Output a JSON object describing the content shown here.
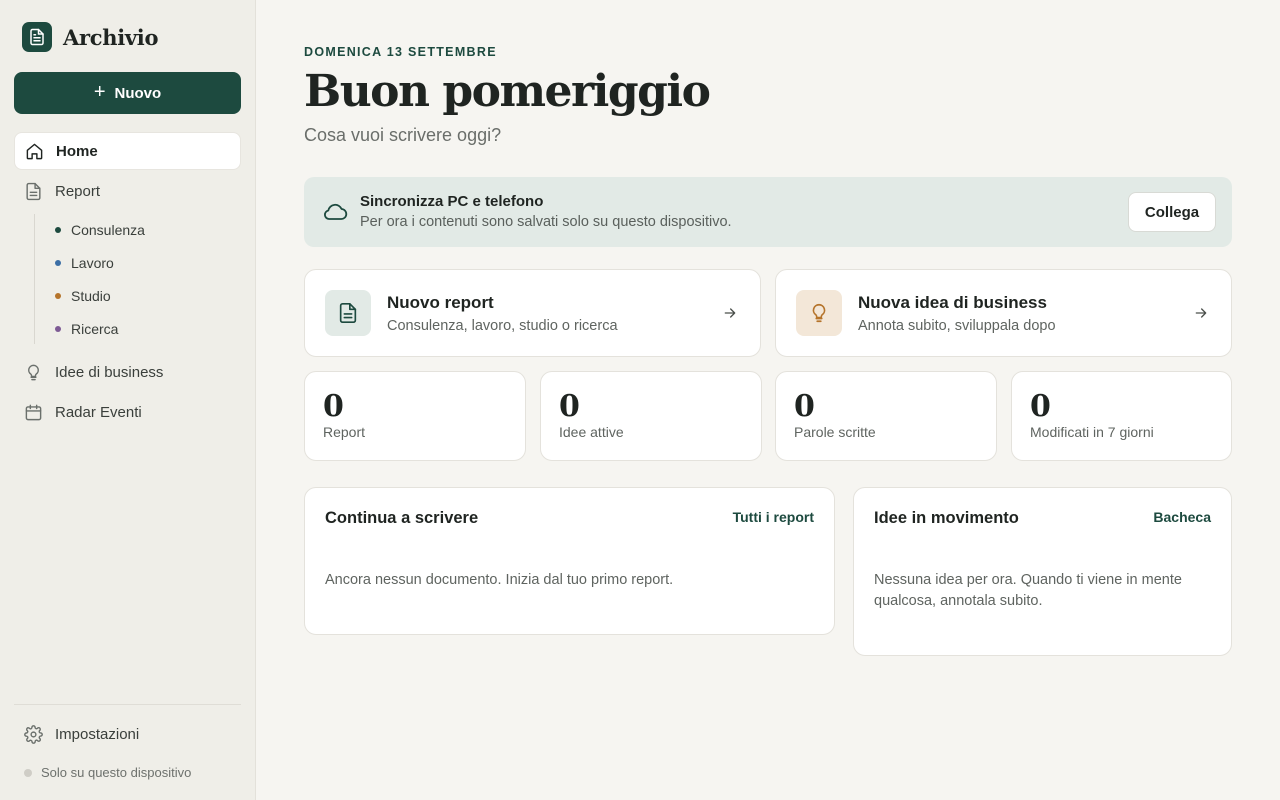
{
  "app": {
    "name": "Archivio"
  },
  "sidebar": {
    "new_label": "Nuovo",
    "nav": {
      "home": "Home",
      "report": "Report",
      "ideas": "Idee di business",
      "radar": "Radar Eventi",
      "settings": "Impostazioni"
    },
    "report_categories": [
      {
        "label": "Consulenza",
        "color": "#1d4a3f"
      },
      {
        "label": "Lavoro",
        "color": "#3b6ea5"
      },
      {
        "label": "Studio",
        "color": "#b5742b"
      },
      {
        "label": "Ricerca",
        "color": "#7d5a94"
      }
    ],
    "storage_note": "Solo su questo dispositivo"
  },
  "header": {
    "date": "DOMENICA 13 SETTEMBRE",
    "greeting": "Buon pomeriggio",
    "subtitle": "Cosa vuoi scrivere oggi?"
  },
  "sync_banner": {
    "title": "Sincronizza PC e telefono",
    "text": "Per ora i contenuti sono salvati solo su questo dispositivo.",
    "button": "Collega"
  },
  "actions": [
    {
      "title": "Nuovo report",
      "subtitle": "Consulenza, lavoro, studio o ricerca",
      "icon": "document-icon",
      "icon_bg": "#e2eae6",
      "icon_color": "#1d4a3f"
    },
    {
      "title": "Nuova idea di business",
      "subtitle": "Annota subito, sviluppala dopo",
      "icon": "lightbulb-icon",
      "icon_bg": "#f3e7d8",
      "icon_color": "#b5742b"
    }
  ],
  "stats": [
    {
      "value": "0",
      "label": "Report"
    },
    {
      "value": "0",
      "label": "Idee attive"
    },
    {
      "value": "0",
      "label": "Parole scritte"
    },
    {
      "value": "0",
      "label": "Modificati in 7 giorni"
    }
  ],
  "panels": {
    "writing": {
      "title": "Continua a scrivere",
      "link": "Tutti i report",
      "empty": "Ancora nessun documento. Inizia dal tuo primo report."
    },
    "ideas": {
      "title": "Idee in movimento",
      "link": "Bacheca",
      "empty": "Nessuna idea per ora. Quando ti viene in mente qualcosa, annotala subito."
    }
  },
  "colors": {
    "accent": "#1d4a3f",
    "background": "#f6f5f1",
    "sidebar": "#efeee8"
  }
}
